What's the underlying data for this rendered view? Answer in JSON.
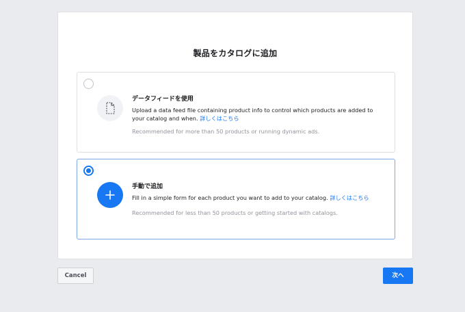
{
  "dialog": {
    "title": "製品をカタログに追加"
  },
  "options": [
    {
      "id": "data-feed",
      "selected": false,
      "icon": "document-icon",
      "title": "データフィードを使用",
      "description": "Upload a data feed file containing product info to control which products are added to your catalog and when.",
      "link": "詳しくはこちら",
      "note": "Recommended for more than 50 products or running dynamic ads."
    },
    {
      "id": "manual",
      "selected": true,
      "icon": "plus-icon",
      "title": "手動で追加",
      "description": "Fill in a simple form for each product you want to add to your catalog.",
      "link": "詳しくはこちら",
      "note": "Recommended for less than 50 products or getting started with catalogs."
    }
  ],
  "footer": {
    "cancel_label": "Cancel",
    "next_label": "次へ"
  },
  "colors": {
    "accent": "#1877f2",
    "background": "#e9ebee",
    "muted_text": "#90949c"
  }
}
